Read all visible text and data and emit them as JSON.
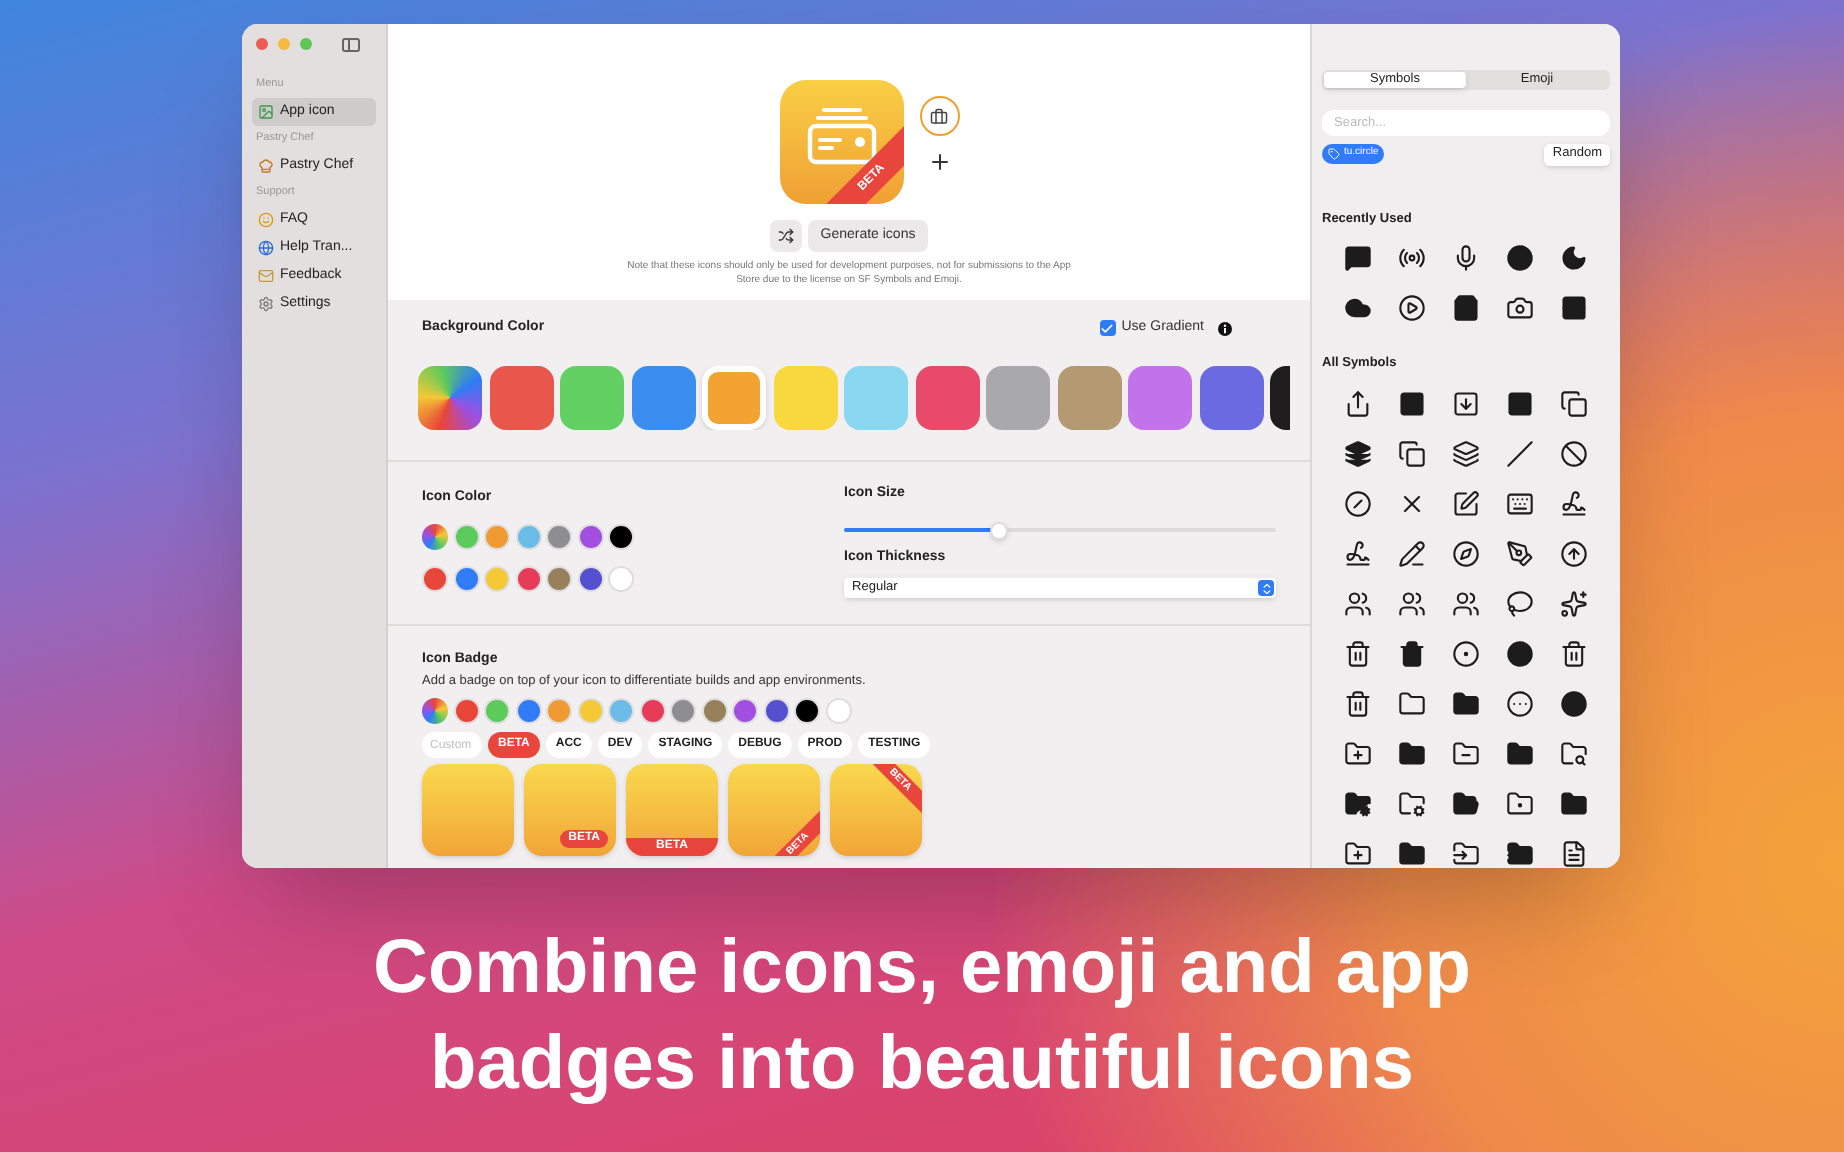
{
  "sidebar": {
    "sections": [
      {
        "header": "Menu",
        "items": [
          {
            "label": "App icon",
            "selected": true
          }
        ]
      },
      {
        "header": "Pastry Chef",
        "items": [
          {
            "label": "Pastry Chef",
            "selected": false
          }
        ]
      },
      {
        "header": "Support",
        "items": [
          {
            "label": "FAQ",
            "selected": false
          },
          {
            "label": "Help Tran...",
            "selected": false
          },
          {
            "label": "Feedback",
            "selected": false
          },
          {
            "label": "Settings",
            "selected": false
          }
        ]
      }
    ]
  },
  "preview": {
    "badge_label": "BETA",
    "generate_button": "Generate icons",
    "note": "Note that these icons should only be used for development purposes, not for submissions to the App Store due to the license on SF Symbols and Emoji."
  },
  "background_color": {
    "title": "Background Color",
    "use_gradient": {
      "label": "Use Gradient",
      "checked": true
    },
    "swatches": [
      {
        "kind": "rainbow",
        "selected": false
      },
      {
        "kind": "solid",
        "color": "#e8574c",
        "selected": false
      },
      {
        "kind": "solid",
        "color": "#62d062",
        "selected": false
      },
      {
        "kind": "solid",
        "color": "#3b8ef0",
        "selected": false
      },
      {
        "kind": "solid",
        "color": "#f2a332",
        "selected": true
      },
      {
        "kind": "solid",
        "color": "#f8d83c",
        "selected": false
      },
      {
        "kind": "solid",
        "color": "#8ad8f0",
        "selected": false
      },
      {
        "kind": "solid",
        "color": "#e84a6a",
        "selected": false
      },
      {
        "kind": "solid",
        "color": "#a9a9ad",
        "selected": false
      },
      {
        "kind": "solid",
        "color": "#b39a72",
        "selected": false
      },
      {
        "kind": "solid",
        "color": "#c272ea",
        "selected": false
      },
      {
        "kind": "solid",
        "color": "#6c6ae0",
        "selected": false
      },
      {
        "kind": "solid",
        "color": "#1e1e1e",
        "selected": false
      }
    ]
  },
  "icon_color": {
    "title": "Icon Color",
    "rows": [
      [
        {
          "kind": "rainbow"
        },
        {
          "kind": "solid",
          "color": "#5ccb5c"
        },
        {
          "kind": "solid",
          "color": "#f09a32"
        },
        {
          "kind": "solid",
          "color": "#6cbce8"
        },
        {
          "kind": "solid",
          "color": "#8e8e92"
        },
        {
          "kind": "solid",
          "color": "#a24ee0"
        },
        {
          "kind": "solid",
          "color": "#000000"
        }
      ],
      [
        {
          "kind": "solid",
          "color": "#e84638"
        },
        {
          "kind": "solid",
          "color": "#2f7cf6"
        },
        {
          "kind": "solid",
          "color": "#f5c836"
        },
        {
          "kind": "solid",
          "color": "#e63c58"
        },
        {
          "kind": "solid",
          "color": "#98805a"
        },
        {
          "kind": "solid",
          "color": "#5450d0"
        },
        {
          "kind": "solid",
          "color": "#ffffff"
        }
      ]
    ]
  },
  "icon_size": {
    "title": "Icon Size",
    "level": 0.36
  },
  "icon_thickness": {
    "title": "Icon Thickness",
    "value": "Regular"
  },
  "icon_badge": {
    "title": "Icon Badge",
    "description": "Add a badge on top of your icon to differentiate builds and app environments.",
    "colors": [
      {
        "kind": "rainbow"
      },
      {
        "kind": "solid",
        "color": "#e84638"
      },
      {
        "kind": "solid",
        "color": "#5ccb5c"
      },
      {
        "kind": "solid",
        "color": "#2f7cf6"
      },
      {
        "kind": "solid",
        "color": "#f09a32"
      },
      {
        "kind": "solid",
        "color": "#f5c836"
      },
      {
        "kind": "solid",
        "color": "#6cbce8"
      },
      {
        "kind": "solid",
        "color": "#e63c58"
      },
      {
        "kind": "solid",
        "color": "#8e8e92"
      },
      {
        "kind": "solid",
        "color": "#98805a"
      },
      {
        "kind": "solid",
        "color": "#a24ee0"
      },
      {
        "kind": "solid",
        "color": "#5450d0"
      },
      {
        "kind": "solid",
        "color": "#000000"
      },
      {
        "kind": "solid",
        "color": "#ffffff"
      }
    ],
    "custom_placeholder": "Custom",
    "labels": [
      {
        "label": "BETA",
        "selected": true
      },
      {
        "label": "ACC",
        "selected": false
      },
      {
        "label": "DEV",
        "selected": false
      },
      {
        "label": "STAGING",
        "selected": false
      },
      {
        "label": "DEBUG",
        "selected": false
      },
      {
        "label": "PROD",
        "selected": false
      },
      {
        "label": "TESTING",
        "selected": false
      }
    ],
    "styles": [
      {
        "kind": "none"
      },
      {
        "kind": "pill",
        "label": "BETA"
      },
      {
        "kind": "band",
        "label": "BETA"
      },
      {
        "kind": "corner_bottom",
        "label": "BETA"
      },
      {
        "kind": "corner_top",
        "label": "BETA"
      }
    ]
  },
  "symbols_panel": {
    "tabs": [
      {
        "label": "Symbols",
        "selected": true
      },
      {
        "label": "Emoji",
        "selected": false
      }
    ],
    "search_placeholder": "Search...",
    "selected_symbol": "tu.circle",
    "random_button": "Random",
    "recently_used_title": "Recently Used",
    "all_symbols_title": "All Symbols"
  },
  "caption": [
    "Combine icons, emoji and app",
    "badges into beautiful icons"
  ]
}
